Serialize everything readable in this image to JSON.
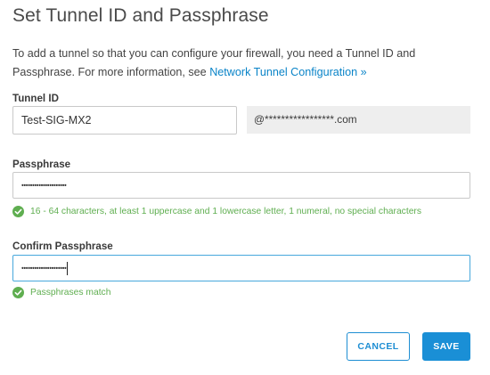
{
  "dialog": {
    "title": "Set Tunnel ID and Passphrase",
    "intro_text": "To add a tunnel so that you can configure your firewall, you need a Tunnel ID and Passphrase. For more information, see ",
    "intro_link": "Network Tunnel Configuration »"
  },
  "tunnel_id": {
    "label": "Tunnel ID",
    "value": "Test-SIG-MX2",
    "suffix": "@*****************.com"
  },
  "passphrase": {
    "label": "Passphrase",
    "masked_value": "•••••••••••••••••••••",
    "hint": "16 - 64 characters, at least 1 uppercase and 1 lowercase letter, 1 numeral, no special characters"
  },
  "confirm_passphrase": {
    "label": "Confirm Passphrase",
    "masked_value": "•••••••••••••••••••••",
    "hint": "Passphrases match"
  },
  "buttons": {
    "cancel": "CANCEL",
    "save": "SAVE"
  },
  "colors": {
    "accent": "#1a8fd6",
    "link": "#0a84c8",
    "success": "#5fae50"
  },
  "icons": {
    "validation": "check-circle-icon"
  }
}
